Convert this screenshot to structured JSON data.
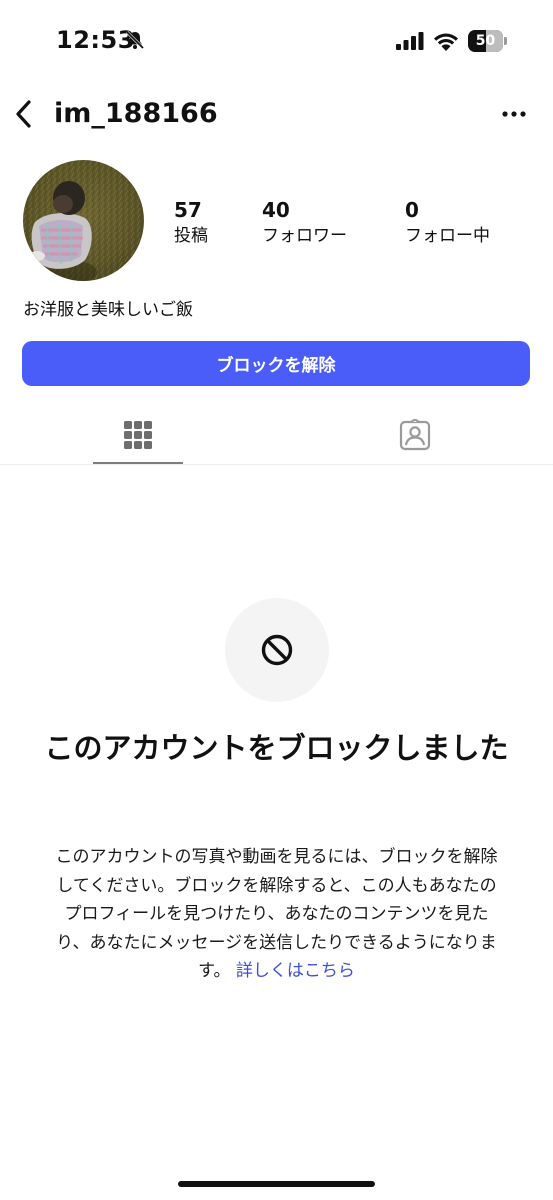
{
  "status_bar": {
    "time": "12:53",
    "battery_percent": "50",
    "icons": [
      "bell-slash-icon",
      "signal-icon",
      "wifi-icon",
      "battery-icon"
    ]
  },
  "header": {
    "username": "im_188166",
    "back_icon": "chevron-left-icon",
    "more_icon": "more-horizontal-icon"
  },
  "profile": {
    "stats": [
      {
        "value": "57",
        "label": "投稿"
      },
      {
        "value": "40",
        "label": "フォロワー"
      },
      {
        "value": "0",
        "label": "フォロー中"
      }
    ],
    "bio": "お洋服と美味しいご飯",
    "unblock_label": "ブロックを解除"
  },
  "tabs": [
    {
      "name": "grid",
      "icon": "grid-icon",
      "active": true
    },
    {
      "name": "tagged",
      "icon": "tagged-person-icon",
      "active": false
    }
  ],
  "blocked": {
    "icon": "block-icon",
    "title": "このアカウントをブロックしました",
    "description": "このアカウントの写真や動画を見るには、ブロックを解除してください。ブロックを解除すると、この人もあなたのプロフィールを見つけたり、あなたのコンテンツを見たり、あなたにメッセージを送信したりできるようになります。",
    "link_label": "詳しくはこちら"
  },
  "colors": {
    "accent": "#4a5df9",
    "link": "#3d4fd8",
    "text": "#111111"
  }
}
